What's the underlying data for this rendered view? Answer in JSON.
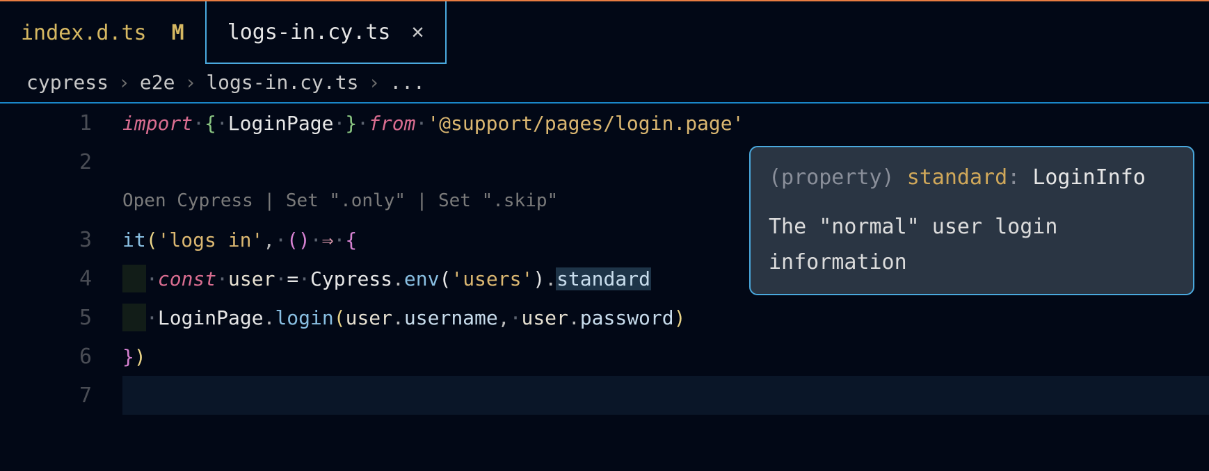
{
  "tabs": {
    "inactive": {
      "label": "index.d.ts",
      "badge": "M"
    },
    "active": {
      "label": "logs-in.cy.ts"
    }
  },
  "breadcrumb": {
    "p0": "cypress",
    "p1": "e2e",
    "p2": "logs-in.cy.ts",
    "p3": "..."
  },
  "gutter": {
    "l1": "1",
    "l2": "2",
    "l3": "3",
    "l4": "4",
    "l5": "5",
    "l6": "6",
    "l7": "7"
  },
  "codelens": {
    "c0": "Open Cypress",
    "c1": "Set \".only\"",
    "c2": "Set \".skip\""
  },
  "code": {
    "import_kw": "import",
    "import_name": "LoginPage",
    "from_kw": "from",
    "import_path": "'@support/pages/login.page'",
    "it_fn": "it",
    "it_label": "'logs in'",
    "const_kw": "const",
    "user_var": "user",
    "cypress": "Cypress",
    "env_fn": "env",
    "env_arg": "'users'",
    "standard_prop": "standard",
    "loginpage": "LoginPage",
    "login_fn": "login",
    "user_a": "user",
    "username": "username",
    "user_b": "user",
    "password": "password"
  },
  "hover": {
    "prefix": "(property) ",
    "name": "standard",
    "colon": ": ",
    "type": "LoginInfo",
    "desc": "The \"normal\" user login information"
  }
}
